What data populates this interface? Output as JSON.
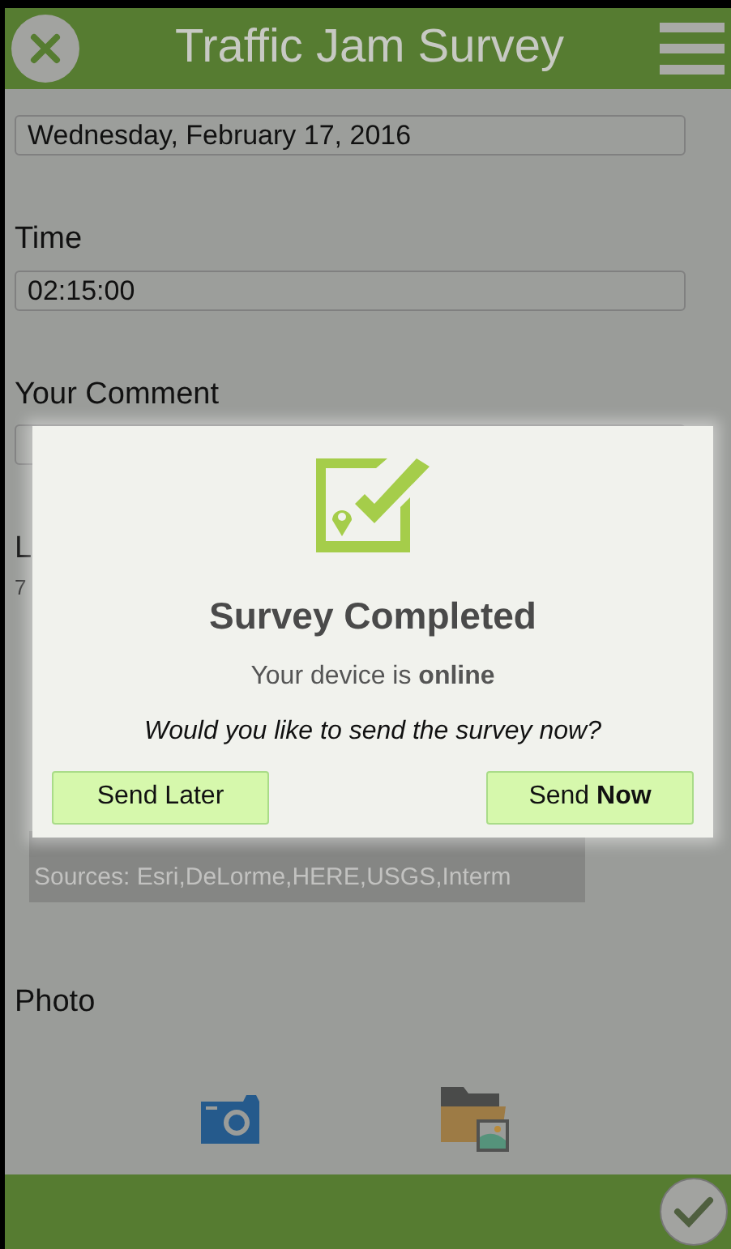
{
  "header": {
    "title": "Traffic Jam Survey"
  },
  "form": {
    "date_value": "Wednesday, February 17, 2016",
    "time_label": "Time",
    "time_value": "02:15:00",
    "comment_label": "Your Comment",
    "location_label": "L",
    "location_value": "7",
    "map_attribution": "Sources: Esri,DeLorme,HERE,USGS,Interm",
    "photo_label": "Photo"
  },
  "dialog": {
    "title": "Survey Completed",
    "status": "Your device is **online**",
    "question": "Would you like to send the survey now?",
    "buttons": [
      {
        "label": "Send Later"
      },
      {
        "label": "Send **Now**"
      }
    ]
  }
}
